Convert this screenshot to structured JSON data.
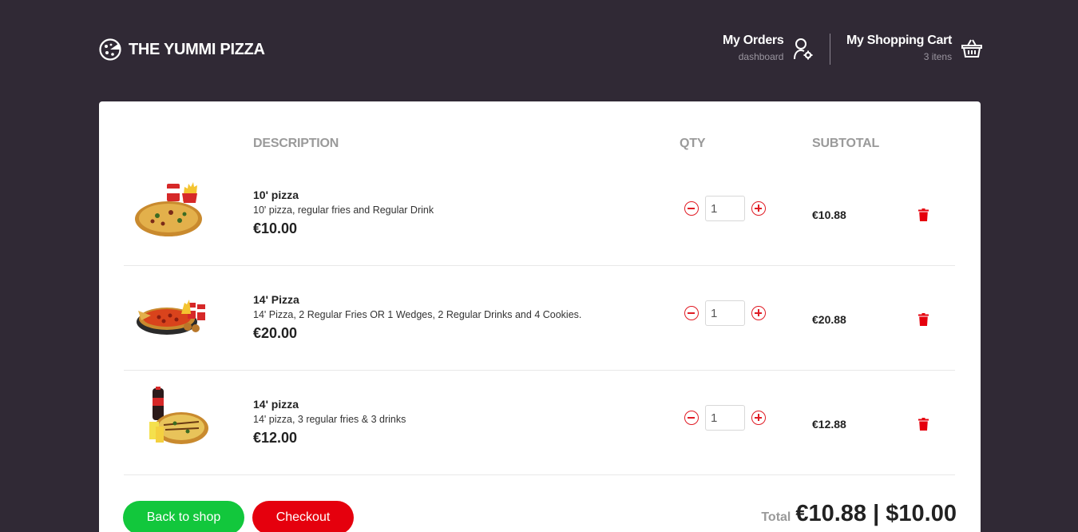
{
  "brand": {
    "name": "THE YUMMI PIZZA",
    "logo_icon": "pizza-icon"
  },
  "nav": {
    "orders": {
      "title": "My Orders",
      "subtitle": "dashboard",
      "icon": "user-gear-icon"
    },
    "cart": {
      "title": "My Shopping Cart",
      "subtitle": "3 itens",
      "icon": "basket-icon"
    }
  },
  "table": {
    "headers": {
      "description": "DESCRIPTION",
      "qty": "QTY",
      "subtotal": "SUBTOTAL"
    },
    "rows": [
      {
        "name": "10' pizza",
        "description": "10' pizza, regular fries and Regular Drink",
        "price": "€10.00",
        "qty": "1",
        "subtotal": "€10.88"
      },
      {
        "name": "14' Pizza",
        "description": "14' Pizza, 2 Regular Fries OR 1 Wedges, 2 Regular Drinks and 4 Cookies.",
        "price": "€20.00",
        "qty": "1",
        "subtotal": "€20.88"
      },
      {
        "name": "14' pizza",
        "description": "14' pizza, 3 regular fries & 3 drinks",
        "price": "€12.00",
        "qty": "1",
        "subtotal": "€12.88"
      }
    ]
  },
  "actions": {
    "back": "Back to shop",
    "checkout": "Checkout"
  },
  "total": {
    "label": "Total",
    "value": "€10.88 | $10.00"
  },
  "colors": {
    "background": "#302935",
    "accent_red": "#e5000d",
    "accent_green": "#12c73c"
  }
}
